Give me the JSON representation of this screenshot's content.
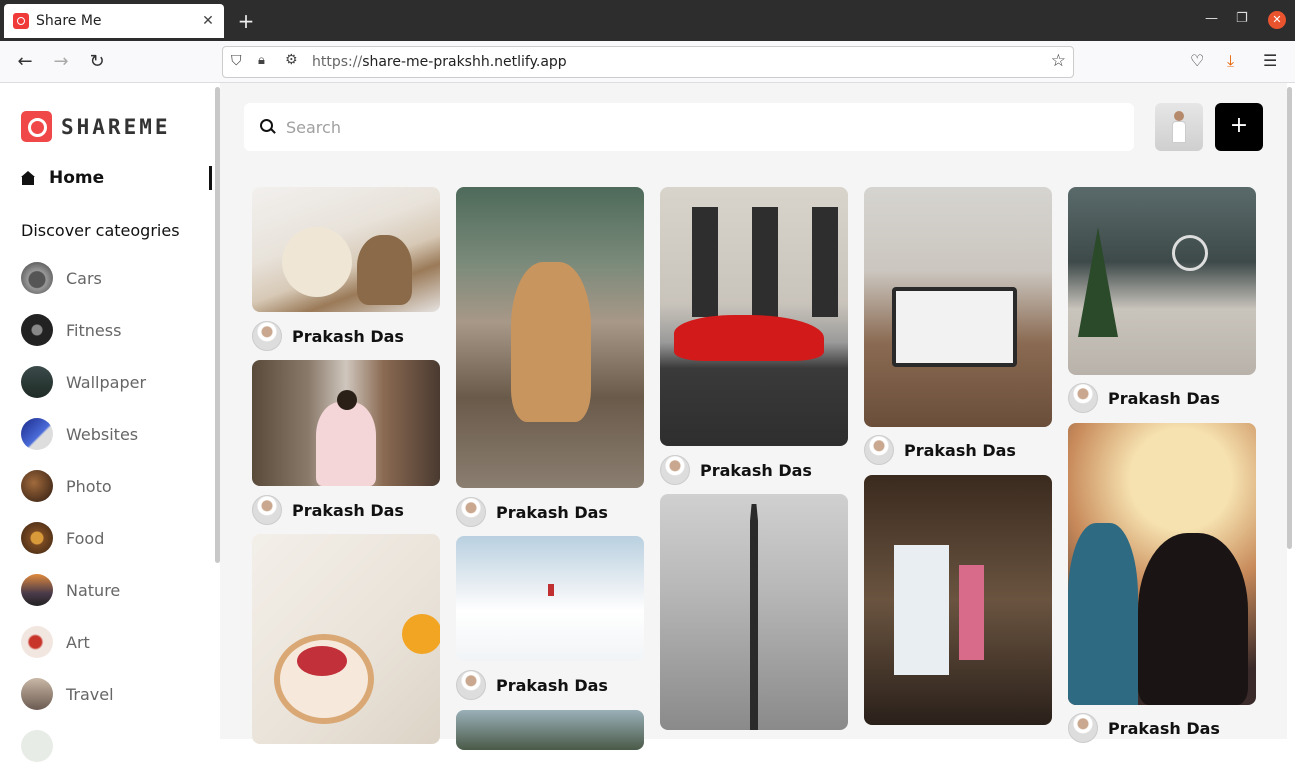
{
  "browser": {
    "tab_title": "Share Me",
    "tab_close": "✕",
    "new_tab": "+",
    "url_scheme": "https://",
    "url_host": "share-me-prakshh.netlify.app"
  },
  "sidebar": {
    "logo_text": "SHAREME",
    "home_label": "Home",
    "discover_label": "Discover cateogries",
    "categories": [
      {
        "label": "Cars"
      },
      {
        "label": "Fitness"
      },
      {
        "label": "Wallpaper"
      },
      {
        "label": "Websites"
      },
      {
        "label": "Photo"
      },
      {
        "label": "Food"
      },
      {
        "label": "Nature"
      },
      {
        "label": "Art"
      },
      {
        "label": "Travel"
      }
    ]
  },
  "header": {
    "search_placeholder": "Search",
    "add_label": "+"
  },
  "pins": [
    {
      "author": "Prakash Das",
      "subject": "dog and cat under blanket"
    },
    {
      "author": "Prakash Das",
      "subject": "girl taking photo in street"
    },
    {
      "author": "",
      "subject": "strawberry tart"
    },
    {
      "author": "Prakash Das",
      "subject": "golden retriever with flower"
    },
    {
      "author": "Prakash Das",
      "subject": "snowy landscape"
    },
    {
      "author": "",
      "subject": "mountain"
    },
    {
      "author": "Prakash Das",
      "subject": "red sports car"
    },
    {
      "author": "",
      "subject": "eiffel tower"
    },
    {
      "author": "Prakash Das",
      "subject": "laptop on desk"
    },
    {
      "author": "",
      "subject": "art gallery"
    },
    {
      "author": "Prakash Das",
      "subject": "living room with christmas tree"
    },
    {
      "author": "Prakash Das",
      "subject": "couple under lights"
    }
  ]
}
